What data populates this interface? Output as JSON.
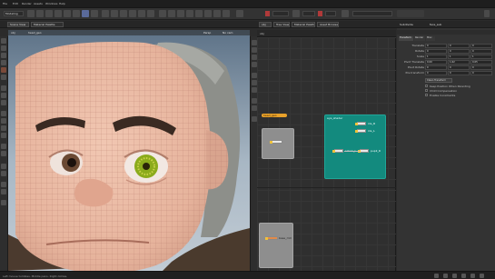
{
  "menubar": {
    "items": [
      "File",
      "Edit",
      "Render",
      "Assets",
      "Windows",
      "Help"
    ]
  },
  "toolbar": {
    "desktop": "Modeling",
    "frame_field": "",
    "search": ""
  },
  "viewport": {
    "tab_label": "Scene View",
    "tab2_label": "Material Palette",
    "path": "obj",
    "node": "head_geo",
    "camera": "Persp",
    "display": "No cam"
  },
  "network": {
    "tabs": [
      "obj",
      "Tree View",
      "Material Palette",
      "Asset Browser"
    ],
    "path": "obj",
    "node_a": "head_geo",
    "node_b": "eye_shader",
    "node_c": "face_skin",
    "mini_nodes": [
      "iris_R",
      "iris_L",
      "sclera_L",
      "pupil_R",
      "base_mtl"
    ]
  },
  "params": {
    "title": "Subdivide",
    "node_name": "face_sub",
    "tabs": [
      "Transform",
      "Render",
      "Misc"
    ],
    "rows": [
      {
        "label": "Translate",
        "values": [
          "0",
          "0",
          "0"
        ]
      },
      {
        "label": "Rotate",
        "values": [
          "0",
          "0",
          "0"
        ]
      },
      {
        "label": "Scale",
        "values": [
          "1",
          "1",
          "1"
        ]
      },
      {
        "label": "Pivot Translate",
        "values": [
          "0.00",
          "1.62",
          "0.05"
        ]
      },
      {
        "label": "Pivot Rotate",
        "values": [
          "0",
          "0",
          "0"
        ]
      },
      {
        "label": "Pre-transform",
        "values": [
          "0",
          "0",
          "0"
        ]
      }
    ],
    "button": "Clean Transform",
    "checks": [
      "Keep Position When Parenting",
      "Child Compensation",
      "Enable Constraints"
    ]
  },
  "status": {
    "text": "Left mouse tumbles. Middle pans. Right dollies."
  },
  "colors": {
    "node_green": "#138a7e",
    "node_gray": "#8e8e8e",
    "node_orange": "#e8a12a",
    "skin": "#e8b8a0",
    "iris_green": "#8bab1c"
  }
}
